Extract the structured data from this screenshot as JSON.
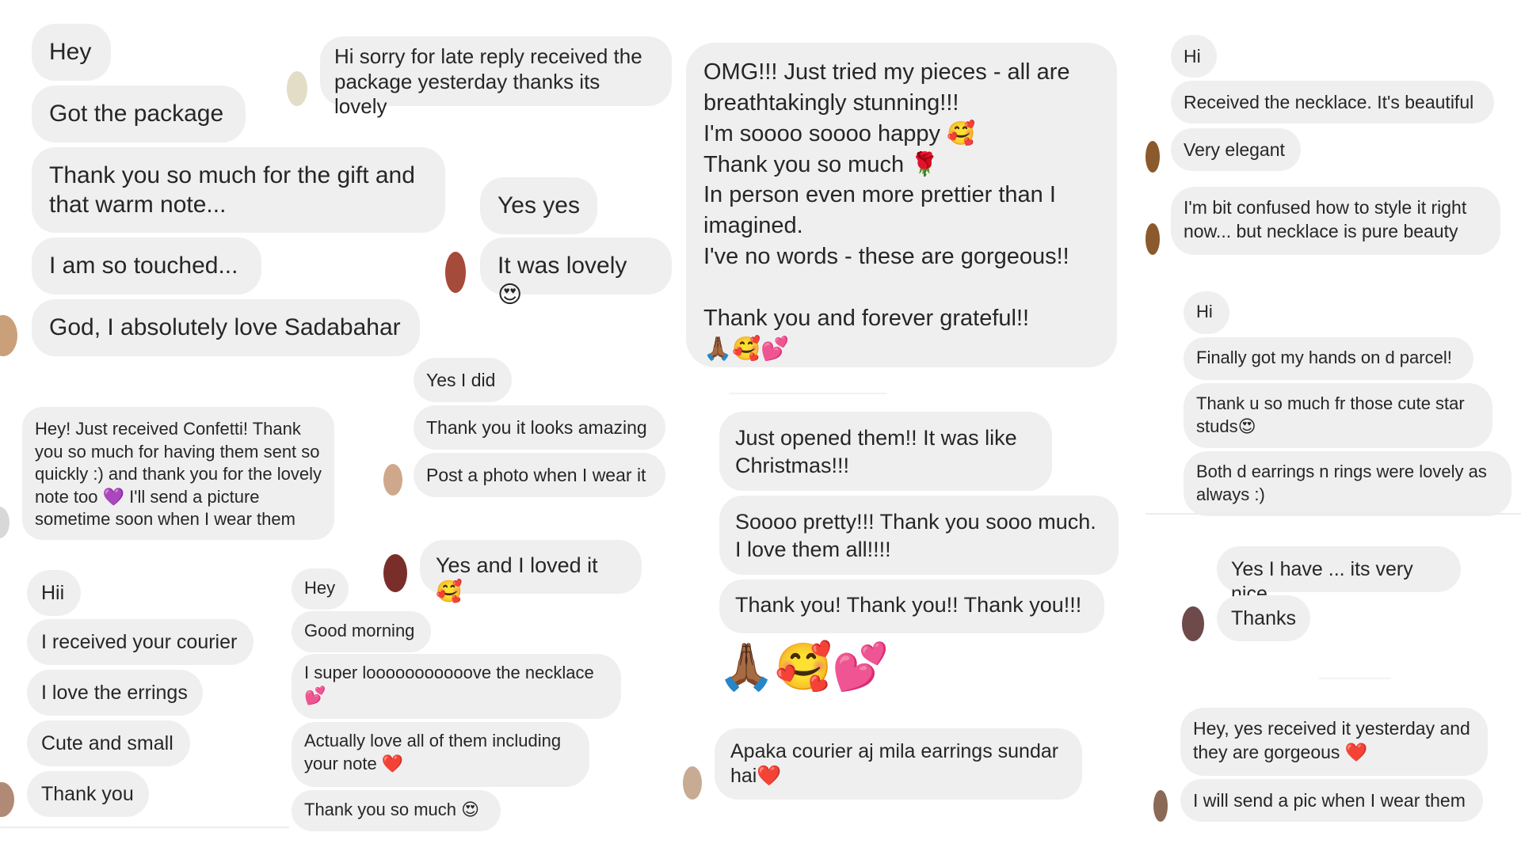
{
  "colors": {
    "bubble": "#efefef",
    "text": "#262626",
    "heart": "#e0245e"
  },
  "col1": {
    "a": [
      "Hey",
      "Got the package",
      "Thank you so much for the gift and\nthat warm note...",
      "I am so touched...",
      "God, I absolutely love Sadabahar"
    ],
    "b": "Hey! Just received Confetti! Thank you so much for having them sent so quickly :) and thank you for the lovely note too 💜 I'll send a picture sometime soon when I wear them",
    "c": [
      "Hii",
      "I received your courier",
      "I love the errings",
      "Cute and small",
      "Thank you"
    ]
  },
  "col2": {
    "a": "Hi sorry for late reply received the package yesterday thanks its lovely",
    "b": [
      "Yes yes",
      "It was lovely 😍"
    ],
    "c": [
      "Yes I did",
      "Thank you it looks amazing",
      "Post a photo when I wear it"
    ],
    "d": "Yes and I loved it 🥰",
    "e": [
      "Hey",
      "Good morning",
      "I super looooooooooove the necklace\n💕",
      "Actually love all of them including\nyour note ❤️",
      "Thank you so much 😍"
    ]
  },
  "col3": {
    "a": "OMG!!! Just tried my pieces - all are breathtakingly stunning!!!\nI'm soooo soooo happy 🥰\nThank you so much 🌹\nIn person even more prettier than I imagined.\nI've no words - these are gorgeous!!\n\nThank you and forever grateful!!\n🙏🏾🥰💕",
    "b": [
      "Just opened them!! It was like\nChristmas!!!",
      "Soooo pretty!!! Thank you sooo much.\nI love them all!!!!",
      "Thank you! Thank you!! Thank you!!!"
    ],
    "emoji": "🙏🏾🥰💕",
    "c": "Apaka courier aj mila earrings sundar hai❤️"
  },
  "col4": {
    "a": [
      "Hi",
      "Received the necklace. It's beautiful",
      "Very elegant",
      "I'm bit confused how to style it right now... but necklace is pure beauty"
    ],
    "b": [
      "Hi",
      "Finally got my hands on d parcel!",
      "Thank u so much fr those cute star studs😍",
      "Both d earrings n rings were lovely as always :)"
    ],
    "c": [
      "Yes I have ... its very nice",
      "Thanks"
    ],
    "d": [
      "Hey, yes received it yesterday and they are gorgeous ❤️",
      "I will send a pic when I wear them"
    ]
  }
}
